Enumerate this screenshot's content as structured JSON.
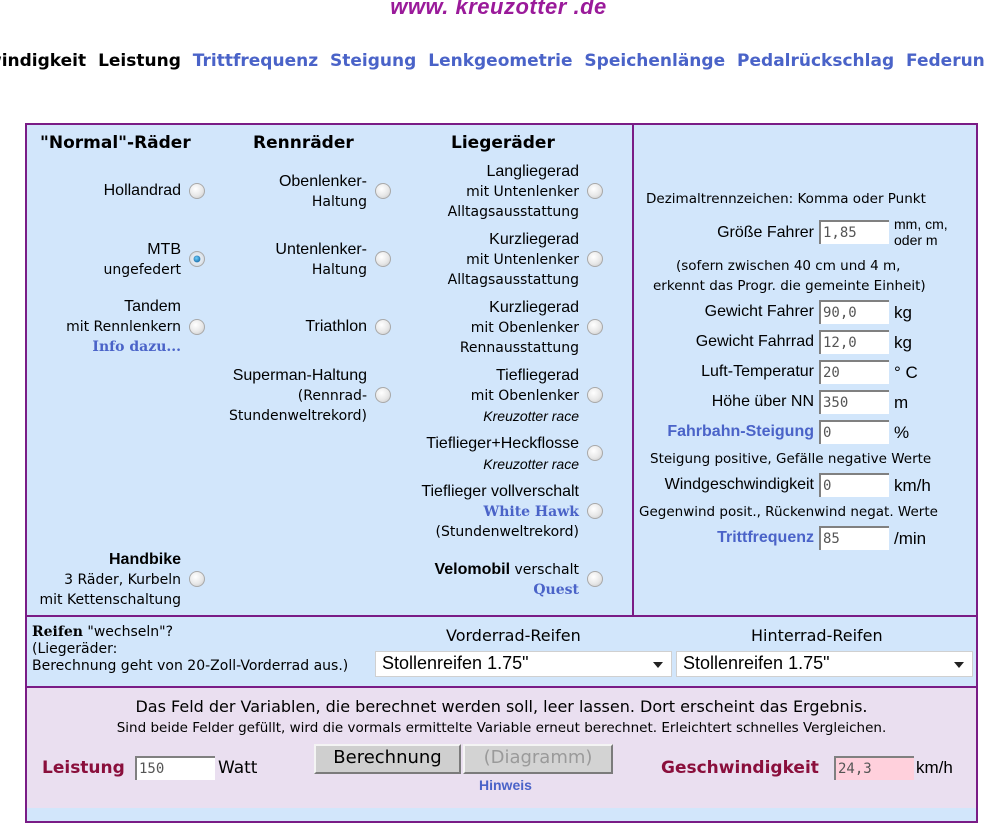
{
  "logo": "www. kreuzotter .de",
  "nav": {
    "current": [
      "windigkeit",
      "Leistung"
    ],
    "links": [
      "Trittfrequenz",
      "Steigung",
      "Lenkgeometrie",
      "Speichenlänge",
      "Pedalrückschlag",
      "Federun"
    ]
  },
  "bikes": {
    "normal": {
      "heading": "\"Normal\"-Räder",
      "hollandrad": {
        "main": "Hollandrad"
      },
      "mtb": {
        "main": "MTB",
        "sub": "ungefedert",
        "checked": true
      },
      "tandem": {
        "main": "Tandem",
        "sub": "mit Rennlenkern",
        "link": "Info dazu..."
      },
      "handbike": {
        "main": "Handbike",
        "sub1": "3 Räder, Kurbeln",
        "sub2": "mit Kettenschaltung"
      }
    },
    "race": {
      "heading": "Rennräder",
      "oben": {
        "main": "Obenlenker-",
        "sub": "Haltung"
      },
      "unten": {
        "main": "Untenlenker-",
        "sub": "Haltung"
      },
      "triathlon": {
        "main": "Triathlon"
      },
      "superman": {
        "main": "Superman-Haltung",
        "sub1": "(Rennrad-",
        "sub2": "Stundenweltrekord)"
      }
    },
    "recumbent": {
      "heading": "Liegeräder",
      "lang": {
        "main": "Langliegerad",
        "sub1": "mit Untenlenker",
        "sub2": "Alltagsausstattung"
      },
      "kurz1": {
        "main": "Kurzliegerad",
        "sub1": "mit Untenlenker",
        "sub2": "Alltagsausstattung"
      },
      "kurz2": {
        "main": "Kurzliegerad",
        "sub1": "mit Obenlenker",
        "sub2": "Rennausstattung"
      },
      "tief": {
        "main": "Tiefliegerad",
        "sub1": "mit Obenlenker",
        "sub2": "Kreuzotter race"
      },
      "heck": {
        "main": "Tieflieger+Heckflosse",
        "sub": "Kreuzotter race"
      },
      "voll": {
        "main": "Tieflieger vollverschalt",
        "link": "White Hawk",
        "sub": "(Stundenweltrekord)"
      },
      "velo": {
        "main": "Velomobil",
        "rest": " verschalt",
        "link": "Quest"
      }
    }
  },
  "params": {
    "decimal_note": "Dezimaltrennzeichen: Komma oder Punkt",
    "height": {
      "label": "Größe Fahrer",
      "value": "1,85",
      "unit1": "mm, cm,",
      "unit2": "oder m"
    },
    "height_note1": "(sofern zwischen 40 cm und 4 m,",
    "height_note2": "erkennt das Progr. die gemeinte Einheit)",
    "rider_weight": {
      "label": "Gewicht Fahrer",
      "value": "90,0",
      "unit": "kg"
    },
    "bike_weight": {
      "label": "Gewicht Fahrrad",
      "value": "12,0",
      "unit": "kg"
    },
    "temperature": {
      "label": "Luft-Temperatur",
      "value": "20",
      "unit": "° C"
    },
    "altitude": {
      "label": "Höhe über NN",
      "value": "350",
      "unit": "m"
    },
    "slope": {
      "label": "Fahrbahn-Steigung",
      "value": "0",
      "unit": "%"
    },
    "slope_note": "Steigung positive, Gefälle negative Werte",
    "wind": {
      "label": "Windgeschwindigkeit",
      "value": "0",
      "unit": "km/h"
    },
    "wind_note": "Gegenwind posit., Rückenwind negat. Werte",
    "cadence": {
      "label": "Trittfrequenz",
      "value": "85",
      "unit": "/min"
    }
  },
  "tires": {
    "title_bold": "Reifen",
    "title_rest": " \"wechseln\"?",
    "note1": "(Liegeräder:",
    "note2": "Berechnung geht von 20-Zoll-Vorderrad aus.)",
    "front_label": "Vorderrad-Reifen",
    "front_value": "Stollenreifen 1.75\"",
    "rear_label": "Hinterrad-Reifen",
    "rear_value": "Stollenreifen 1.75\""
  },
  "calc": {
    "line1": "Das Feld der Variablen, die berechnet werden soll, leer lassen. Dort erscheint das Ergebnis.",
    "line2": "Sind beide Felder gefüllt, wird die vormals ermittelte Variable erneut berechnet. Erleichtert schnelles Vergleichen.",
    "power_label": "Leistung",
    "power_value": "150",
    "power_unit": "Watt",
    "calc_button": "Berechnung",
    "diagram_button": "(Diagramm)",
    "hint_link": "Hinweis",
    "speed_label": "Geschwindigkeit",
    "speed_value": "24,3",
    "speed_unit": "km/h"
  }
}
